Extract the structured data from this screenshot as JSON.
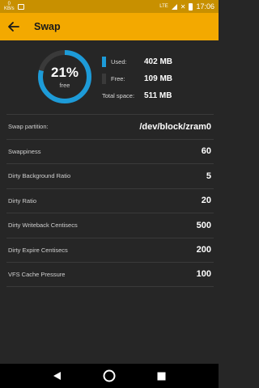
{
  "status_bar": {
    "left_top": "0",
    "left_bottom": "KB/s",
    "network": "LTE",
    "time": "17:06"
  },
  "app_bar": {
    "title": "Swap",
    "back_icon": "arrow-left-icon"
  },
  "summary": {
    "percent_label": "21%",
    "sub_label": "free",
    "free_fraction": 0.21,
    "colors": {
      "used": "#1d9bd8",
      "free": "#3a3a3a"
    },
    "used": {
      "label": "Used:",
      "value": "402 MB"
    },
    "free": {
      "label": "Free:",
      "value": "109 MB"
    },
    "total": {
      "label": "Total space:",
      "value": "511 MB"
    }
  },
  "stats": [
    {
      "label": "Swap partition:",
      "value": "/dev/block/zram0"
    },
    {
      "label": "Swappiness",
      "value": "60"
    },
    {
      "label": "Dirty Background Ratio",
      "value": "5"
    },
    {
      "label": "Dirty Ratio",
      "value": "20"
    },
    {
      "label": "Dirty Writeback Centisecs",
      "value": "500"
    },
    {
      "label": "Dirty Expire Centisecs",
      "value": "200"
    },
    {
      "label": "VFS Cache Pressure",
      "value": "100"
    }
  ],
  "nav": {
    "back": "triangle-back-icon",
    "home": "home-circle-icon",
    "recents": "square-recents-icon"
  }
}
